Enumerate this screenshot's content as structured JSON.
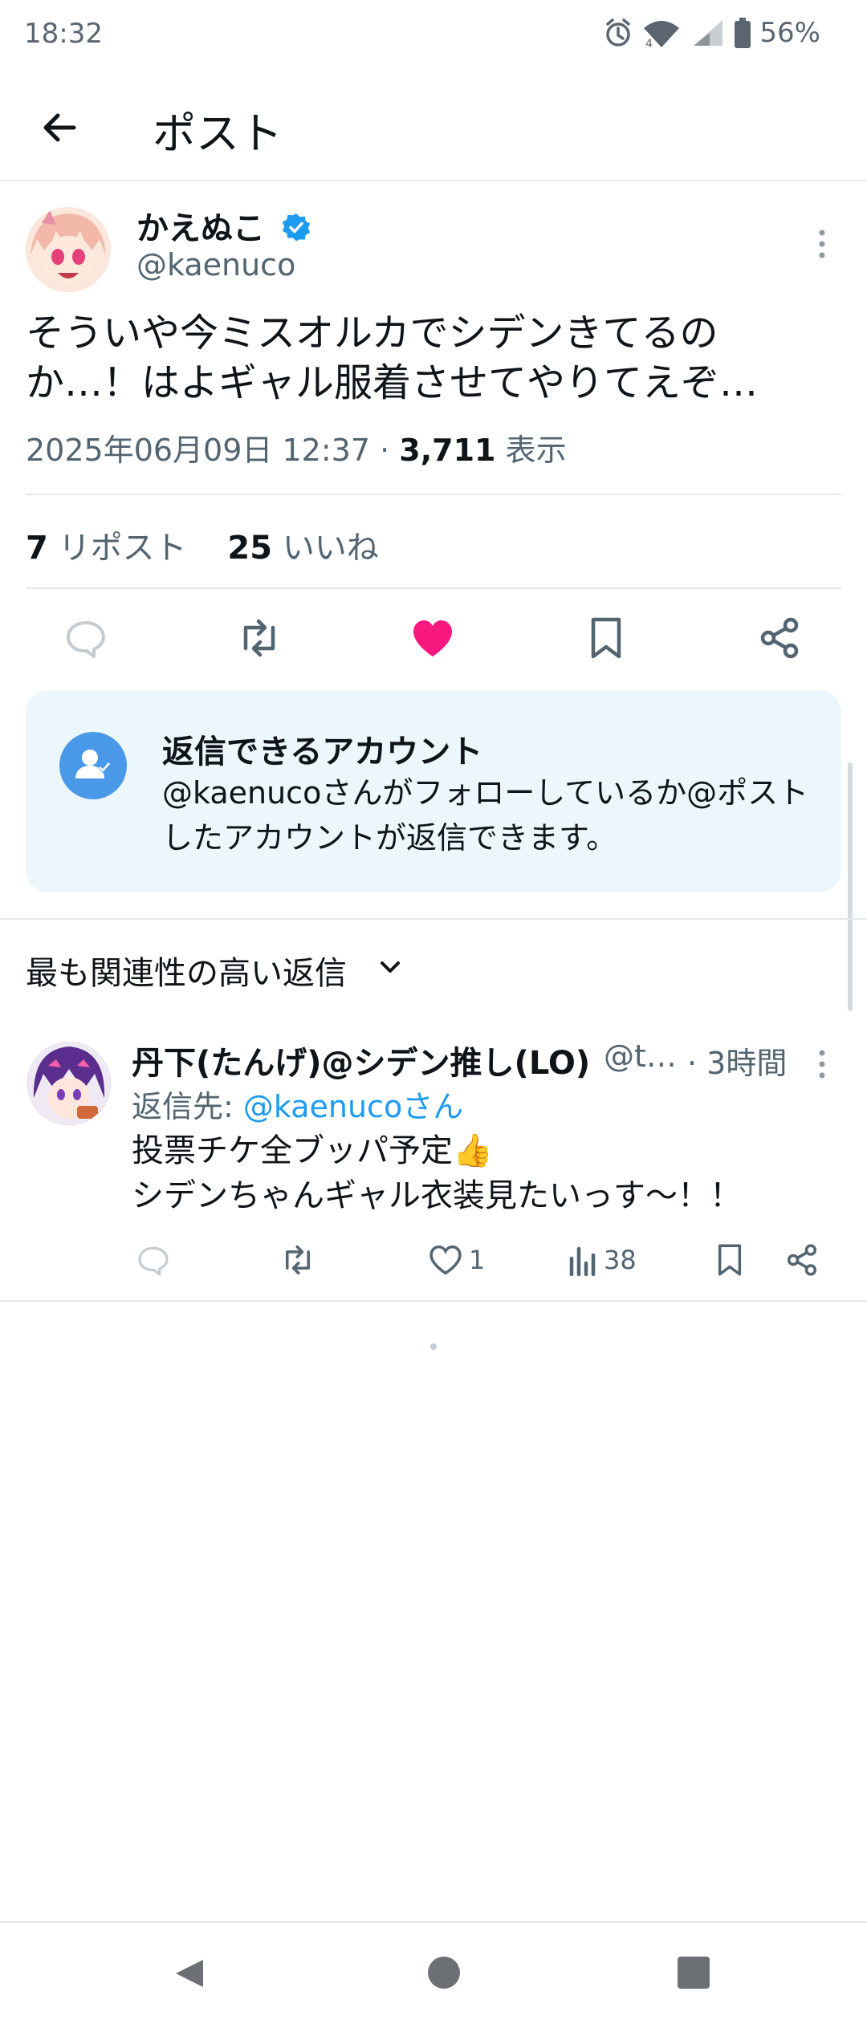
{
  "status_bar": {
    "time": "18:32",
    "battery": "56%",
    "icons": [
      "alarm-icon",
      "wifi-icon",
      "signal-icon",
      "battery-icon"
    ]
  },
  "header": {
    "title": "ポスト",
    "back_icon": "arrow-left-icon"
  },
  "post": {
    "author_name": "かえぬこ",
    "author_handle": "@kaenuco",
    "verified": true,
    "text_line1": "そういや今ミスオルカでシデンきてるの",
    "text_line2": "か…！はよギャル服着させてやりてえぞ…",
    "datetime": "2025年06月09日 12:37",
    "separator": "·",
    "views": "3,711",
    "views_label": "表示",
    "reposts": "7",
    "reposts_label": "リポスト",
    "likes": "25",
    "likes_label": "いいね",
    "liked": true
  },
  "restriction": {
    "title": "返信できるアカウント",
    "description": "@kaenucoさんがフォローしているか@ポストしたアカウントが返信できます。"
  },
  "sort": {
    "label": "最も関連性の高い返信"
  },
  "reply": {
    "name": "丹下(たんげ)@シデン推し(LO)",
    "handle": "@t…",
    "time": "· 3時間",
    "reply_to_prefix": "返信先: ",
    "reply_to_handle": "@kaenucoさん",
    "text_line1": "投票チケ全ブッパ予定👍",
    "text_line2": "シデンちゃんギャル衣装見たいっす〜！！",
    "likes": "1",
    "views": "38"
  },
  "colors": {
    "accent": "#1d9bf0",
    "like": "#f91880",
    "muted": "#536471",
    "card_bg": "#ecf6fd"
  }
}
